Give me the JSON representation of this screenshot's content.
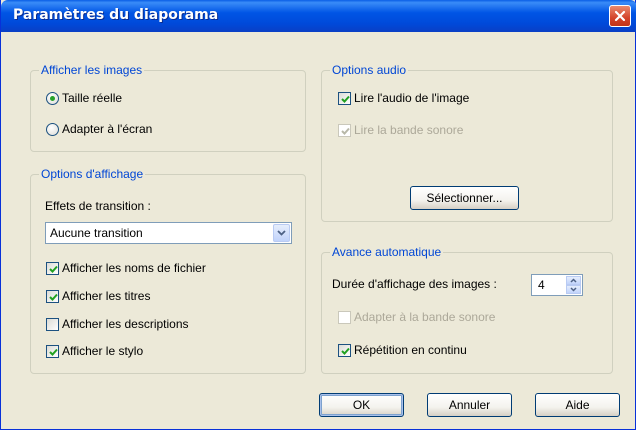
{
  "window": {
    "title": "Paramètres du diaporama"
  },
  "afficher_images": {
    "legend": "Afficher les images",
    "options": [
      {
        "label": "Taille réelle",
        "selected": true
      },
      {
        "label": "Adapter à l'écran",
        "selected": false
      }
    ]
  },
  "options_affichage": {
    "legend": "Options d'affichage",
    "transition_label": "Effets de transition :",
    "transition_value": "Aucune transition",
    "checkboxes": [
      {
        "label": "Afficher les noms de fichier",
        "checked": true
      },
      {
        "label": "Afficher les titres",
        "checked": true
      },
      {
        "label": "Afficher les descriptions",
        "checked": false
      },
      {
        "label": "Afficher le stylo",
        "checked": true
      }
    ]
  },
  "options_audio": {
    "legend": "Options audio",
    "lire_audio": {
      "label": "Lire l'audio de l'image",
      "checked": true,
      "disabled": false
    },
    "lire_bande": {
      "label": "Lire la bande sonore",
      "checked": true,
      "disabled": true
    },
    "select_button": "Sélectionner..."
  },
  "avance_auto": {
    "legend": "Avance automatique",
    "duree_label": "Durée d'affichage des images :",
    "duree_value": "4",
    "adapter": {
      "label": "Adapter à la bande sonore",
      "checked": false,
      "disabled": true
    },
    "repetition": {
      "label": "Répétition en continu",
      "checked": true,
      "disabled": false
    }
  },
  "buttons": {
    "ok": "OK",
    "cancel": "Annuler",
    "help": "Aide"
  },
  "colors": {
    "titlebar": "#0055e5",
    "legend_text": "#0046d5",
    "dialog_bg": "#ece9d8"
  }
}
